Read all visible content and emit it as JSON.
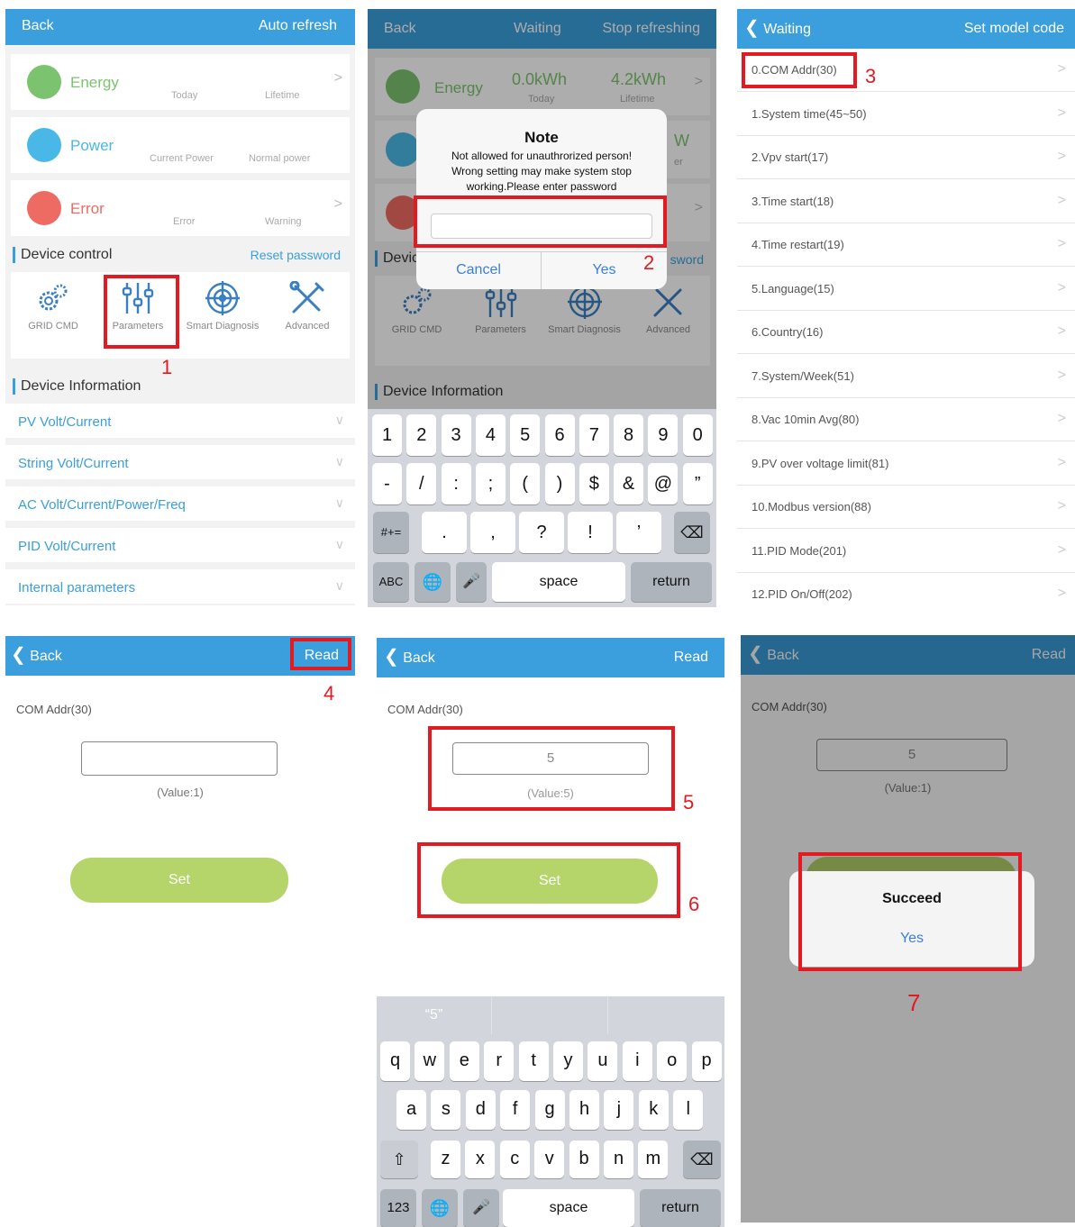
{
  "p1": {
    "back": "Back",
    "refresh": "Auto refresh",
    "cards": [
      {
        "label": "Energy",
        "sub1": "Today",
        "sub2": "Lifetime",
        "color": "#7cc36f"
      },
      {
        "label": "Power",
        "sub1": "Current Power",
        "sub2": "Normal power",
        "color": "#4ab8e6"
      },
      {
        "label": "Error",
        "sub1": "Error",
        "sub2": "Warning",
        "color": "#ee6b64"
      }
    ],
    "device_control": "Device control",
    "reset_password": "Reset password",
    "tools": [
      "GRID CMD",
      "Parameters",
      "Smart Diagnosis",
      "Advanced"
    ],
    "device_information": "Device Information",
    "info_rows": [
      "PV Volt/Current",
      "String Volt/Current",
      "AC Volt/Current/Power/Freq",
      "PID Volt/Current",
      "Internal parameters"
    ],
    "step": "1"
  },
  "p2": {
    "back": "Back",
    "waiting": "Waiting",
    "stop": "Stop refreshing",
    "energy_label": "Energy",
    "today_value": "0.0kWh",
    "lifetime_value": "4.2kWh",
    "today": "Today",
    "lifetime": "Lifetime",
    "dialog_title": "Note",
    "dialog_line1": "Not allowed for unauthrorized person!",
    "dialog_line2": "Wrong setting may make system stop",
    "dialog_line3": "working.Please enter password",
    "cancel": "Cancel",
    "yes": "Yes",
    "peek_w": "W",
    "peek_er": "er",
    "devic": "Devic",
    "sword": "sword",
    "tools": [
      "GRID CMD",
      "Parameters",
      "Smart Diagnosis",
      "Advanced"
    ],
    "device_information": "Device Information",
    "keys_row1": [
      "1",
      "2",
      "3",
      "4",
      "5",
      "6",
      "7",
      "8",
      "9",
      "0"
    ],
    "keys_row2": [
      "-",
      "/",
      ":",
      ";",
      "(",
      ")",
      "$",
      "&",
      "@",
      "”"
    ],
    "keys_row3": [
      ".",
      ",",
      "?",
      "!",
      "’"
    ],
    "key_symbols": "#+=",
    "key_abc": "ABC",
    "key_space": "space",
    "key_return": "return",
    "step": "2"
  },
  "p3": {
    "back": "Waiting",
    "title": "Set model code",
    "items": [
      "0.COM Addr(30)",
      "1.System time(45~50)",
      "2.Vpv start(17)",
      "3.Time start(18)",
      "4.Time restart(19)",
      "5.Language(15)",
      "6.Country(16)",
      "7.System/Week(51)",
      "8.Vac 10min Avg(80)",
      "9.PV over voltage limit(81)",
      "10.Modbus version(88)",
      "11.PID Mode(201)",
      "12.PID On/Off(202)"
    ],
    "step": "3"
  },
  "p4": {
    "back": "Back",
    "read": "Read",
    "field_label": "COM Addr(30)",
    "value_hint": "(Value:1)",
    "set": "Set",
    "step": "4"
  },
  "p5": {
    "back": "Back",
    "read": "Read",
    "field_label": "COM Addr(30)",
    "input_value": "5",
    "value_hint": "(Value:5)",
    "set": "Set",
    "suggestion": "“5”",
    "keys_row1": [
      "q",
      "w",
      "e",
      "r",
      "t",
      "y",
      "u",
      "i",
      "o",
      "p"
    ],
    "keys_row2": [
      "a",
      "s",
      "d",
      "f",
      "g",
      "h",
      "j",
      "k",
      "l"
    ],
    "keys_row3": [
      "z",
      "x",
      "c",
      "v",
      "b",
      "n",
      "m"
    ],
    "key_123": "123",
    "key_space": "space",
    "key_return": "return",
    "step5": "5",
    "step6": "6"
  },
  "p6": {
    "back": "Back",
    "read": "Read",
    "field_label": "COM Addr(30)",
    "input_value": "5",
    "value_hint": "(Value:1)",
    "dialog_title": "Succeed",
    "yes": "Yes",
    "step": "7"
  },
  "colors": {
    "header": "#3a9fdc",
    "highlight": "#e21b23",
    "set_button": "#b5d56a"
  }
}
